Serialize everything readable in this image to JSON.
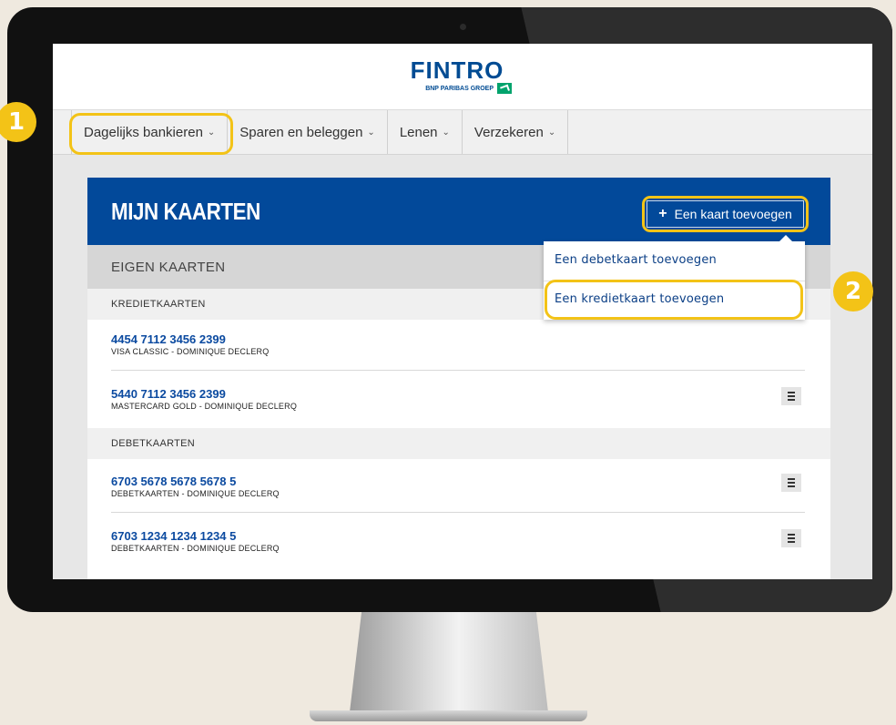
{
  "brand": {
    "name": "FINTRO",
    "group": "BNP PARIBAS GROEP"
  },
  "nav": {
    "items": [
      {
        "label": "Dagelijks bankieren"
      },
      {
        "label": "Sparen en beleggen"
      },
      {
        "label": "Lenen"
      },
      {
        "label": "Verzekeren"
      }
    ],
    "chevron": "⌄"
  },
  "main": {
    "title": "MIJN KAARTEN",
    "add_button": {
      "icon": "+",
      "label": "Een kaart toevoegen"
    },
    "section_title": "EIGEN KAARTEN",
    "credit_header": "KREDIETKAARTEN",
    "debit_header": "DEBETKAARTEN",
    "credit_cards": [
      {
        "number": "4454 7112 3456 2399",
        "holder": "VISA CLASSIC  - DOMINIQUE DECLERQ"
      },
      {
        "number": "5440 7112 3456 2399",
        "holder": "MASTERCARD GOLD - DOMINIQUE DECLERQ"
      }
    ],
    "debit_cards": [
      {
        "number": "6703 5678 5678 5678 5",
        "holder": "DEBETKAARTEN - DOMINIQUE DECLERQ"
      },
      {
        "number": "6703 1234 1234 1234 5",
        "holder": "DEBETKAARTEN - DOMINIQUE DECLERQ"
      }
    ]
  },
  "dropdown": {
    "items": [
      {
        "label": "Een debetkaart toevoegen"
      },
      {
        "label": "Een kredietkaart toevoegen"
      }
    ]
  },
  "steps": {
    "one": "1",
    "two": "2"
  },
  "colors": {
    "brand_blue": "#02499a",
    "highlight_yellow": "#f3c317",
    "logo_green": "#00a36c"
  }
}
